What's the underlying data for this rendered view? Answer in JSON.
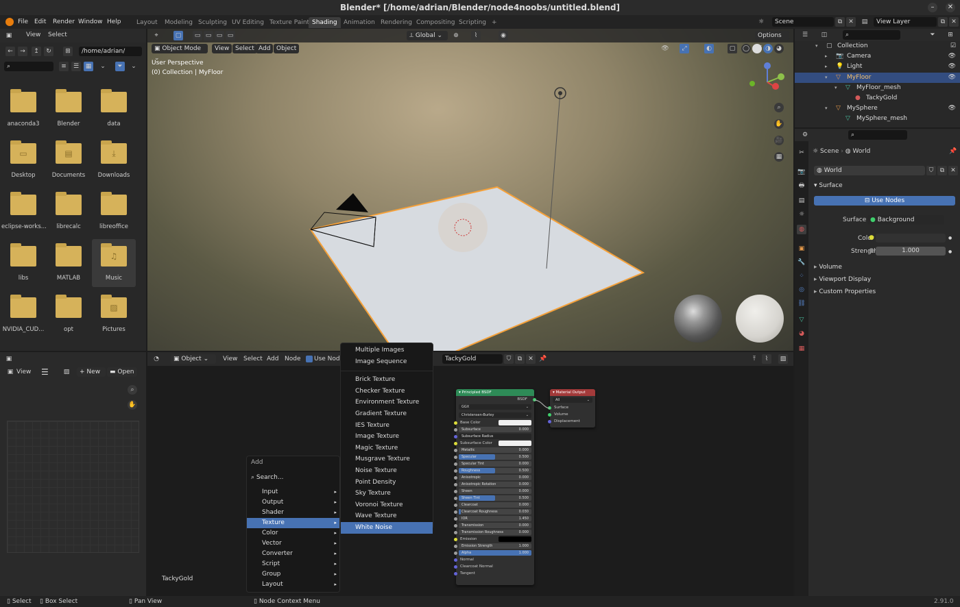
{
  "window": {
    "title": "Blender* [/home/adrian/Blender/node4noobs/untitled.blend]",
    "min": "–",
    "close": "✕"
  },
  "topmenu": [
    "File",
    "Edit",
    "Render",
    "Window",
    "Help"
  ],
  "workspaces": [
    "Layout",
    "Modeling",
    "Sculpting",
    "UV Editing",
    "Texture Paint",
    "Shading",
    "Animation",
    "Rendering",
    "Compositing",
    "Scripting",
    "+"
  ],
  "scene": {
    "name": "Scene",
    "view_layer": "View Layer"
  },
  "filebrowser": {
    "menu": [
      "View",
      "Select"
    ],
    "path": "/home/adrian/",
    "items": [
      {
        "name": "anaconda3",
        "icon": ""
      },
      {
        "name": "Blender",
        "icon": ""
      },
      {
        "name": "data",
        "icon": ""
      },
      {
        "name": "Desktop",
        "icon": "desktop-icon"
      },
      {
        "name": "Documents",
        "icon": "documents-icon"
      },
      {
        "name": "Downloads",
        "icon": "download-icon"
      },
      {
        "name": "eclipse-works...",
        "icon": ""
      },
      {
        "name": "librecalc",
        "icon": ""
      },
      {
        "name": "libreoffice",
        "icon": ""
      },
      {
        "name": "libs",
        "icon": ""
      },
      {
        "name": "MATLAB",
        "icon": ""
      },
      {
        "name": "Music",
        "icon": "music-icon"
      },
      {
        "name": "NVIDIA_CUD...",
        "icon": ""
      },
      {
        "name": "opt",
        "icon": ""
      },
      {
        "name": "Pictures",
        "icon": "pictures-icon"
      }
    ]
  },
  "image_editor": {
    "view": "View",
    "new": "New",
    "open": "Open"
  },
  "viewport": {
    "mode": "Object Mode",
    "menu": [
      "View",
      "Select",
      "Add",
      "Object"
    ],
    "transform": "Global",
    "options": "Options",
    "overlay1": "User Perspective",
    "overlay2": "(0) Collection | MyFloor"
  },
  "outliner": {
    "items": [
      {
        "label": "Collection",
        "indent": 0,
        "icon": "collection-icon",
        "color": "#cccccc",
        "sel": false
      },
      {
        "label": "Camera",
        "indent": 1,
        "icon": "camera-icon",
        "color": "#e69a4a",
        "sel": false
      },
      {
        "label": "Light",
        "indent": 1,
        "icon": "light-icon",
        "color": "#e69a4a",
        "sel": false
      },
      {
        "label": "MyFloor",
        "indent": 1,
        "icon": "mesh-object-icon",
        "color": "#e69a4a",
        "sel": true
      },
      {
        "label": "MyFloor_mesh",
        "indent": 2,
        "icon": "mesh-data-icon",
        "color": "#4ac0a0",
        "sel": false
      },
      {
        "label": "TackyGold",
        "indent": 3,
        "icon": "material-icon",
        "color": "#d45a5a",
        "sel": false
      },
      {
        "label": "MySphere",
        "indent": 1,
        "icon": "mesh-object-icon",
        "color": "#e69a4a",
        "sel": false
      },
      {
        "label": "MySphere_mesh",
        "indent": 2,
        "icon": "mesh-data-icon",
        "color": "#4ac0a0",
        "sel": false
      }
    ]
  },
  "properties": {
    "breadcrumb_scene": "Scene",
    "breadcrumb_world": "World",
    "world_name": "World",
    "surface_header": "Surface",
    "use_nodes": "Use Nodes",
    "surface_label": "Surface",
    "surface_value": "Background",
    "color_label": "Color",
    "strength_label": "Strength",
    "strength_value": "1.000",
    "sections": [
      "Volume",
      "Viewport Display",
      "Custom Properties"
    ]
  },
  "node_editor": {
    "object": "Object",
    "menu": [
      "View",
      "Select",
      "Add",
      "Node"
    ],
    "use_nodes": "Use Nodes",
    "material": "TackyGold",
    "material_label": "TackyGold"
  },
  "add_menu": {
    "title": "Add",
    "search": "Search...",
    "items": [
      "Input",
      "Output",
      "Shader",
      "Texture",
      "Color",
      "Vector",
      "Converter",
      "Script",
      "Group",
      "Layout"
    ],
    "active": "Texture"
  },
  "texture_menu": {
    "items": [
      "Multiple Images",
      "Image Sequence",
      "Brick Texture",
      "Checker Texture",
      "Environment Texture",
      "Gradient Texture",
      "IES Texture",
      "Image Texture",
      "Magic Texture",
      "Musgrave Texture",
      "Noise Texture",
      "Point Density",
      "Sky Texture",
      "Voronoi Texture",
      "Wave Texture",
      "White Noise"
    ],
    "active": "White Noise"
  },
  "bsdf_node": {
    "title": "Principled BSDF",
    "output": "BSDF",
    "dist": "GGX",
    "sss": "Christensen-Burley",
    "rows": [
      {
        "label": "Base Color",
        "kind": "color",
        "value": "",
        "fill": 0
      },
      {
        "label": "Subsurface",
        "kind": "slider",
        "value": "0.000",
        "fill": 0
      },
      {
        "label": "Subsurface Radius",
        "kind": "select",
        "value": "",
        "fill": 0
      },
      {
        "label": "Subsurface Color",
        "kind": "color",
        "value": "",
        "fill": 0
      },
      {
        "label": "Metallic",
        "kind": "slider",
        "value": "0.000",
        "fill": 0
      },
      {
        "label": "Specular",
        "kind": "slider",
        "value": "0.500",
        "fill": 0.5
      },
      {
        "label": "Specular Tint",
        "kind": "slider",
        "value": "0.000",
        "fill": 0
      },
      {
        "label": "Roughness",
        "kind": "slider",
        "value": "0.500",
        "fill": 0.5
      },
      {
        "label": "Anisotropic",
        "kind": "slider",
        "value": "0.000",
        "fill": 0
      },
      {
        "label": "Anisotropic Rotation",
        "kind": "slider",
        "value": "0.000",
        "fill": 0
      },
      {
        "label": "Sheen",
        "kind": "slider",
        "value": "0.000",
        "fill": 0
      },
      {
        "label": "Sheen Tint",
        "kind": "slider",
        "value": "0.500",
        "fill": 0.5
      },
      {
        "label": "Clearcoat",
        "kind": "slider",
        "value": "0.000",
        "fill": 0
      },
      {
        "label": "Clearcoat Roughness",
        "kind": "slider",
        "value": "0.030",
        "fill": 0.03
      },
      {
        "label": "IOR",
        "kind": "slider",
        "value": "1.450",
        "fill": 0
      },
      {
        "label": "Transmission",
        "kind": "slider",
        "value": "0.000",
        "fill": 0
      },
      {
        "label": "Transmission Roughness",
        "kind": "slider",
        "value": "0.000",
        "fill": 0
      },
      {
        "label": "Emission",
        "kind": "black",
        "value": "",
        "fill": 0
      },
      {
        "label": "Emission Strength",
        "kind": "slider",
        "value": "1.000",
        "fill": 0
      },
      {
        "label": "Alpha",
        "kind": "slider",
        "value": "1.000",
        "fill": 1
      },
      {
        "label": "Normal",
        "kind": "plain",
        "value": "",
        "fill": 0
      },
      {
        "label": "Clearcoat Normal",
        "kind": "plain",
        "value": "",
        "fill": 0
      },
      {
        "label": "Tangent",
        "kind": "plain",
        "value": "",
        "fill": 0
      }
    ]
  },
  "output_node": {
    "title": "Material Output",
    "target": "All",
    "inputs": [
      "Surface",
      "Volume",
      "Displacement"
    ]
  },
  "statusbar": {
    "select": "Select",
    "box": "Box Select",
    "pan": "Pan View",
    "ctx": "Node Context Menu",
    "version": "2.91.0"
  },
  "colors": {
    "accent": "#4772b3",
    "selected_orange": "#f5a13a",
    "bsdf_header": "#2e8b57",
    "output_header": "#a33a3a"
  }
}
